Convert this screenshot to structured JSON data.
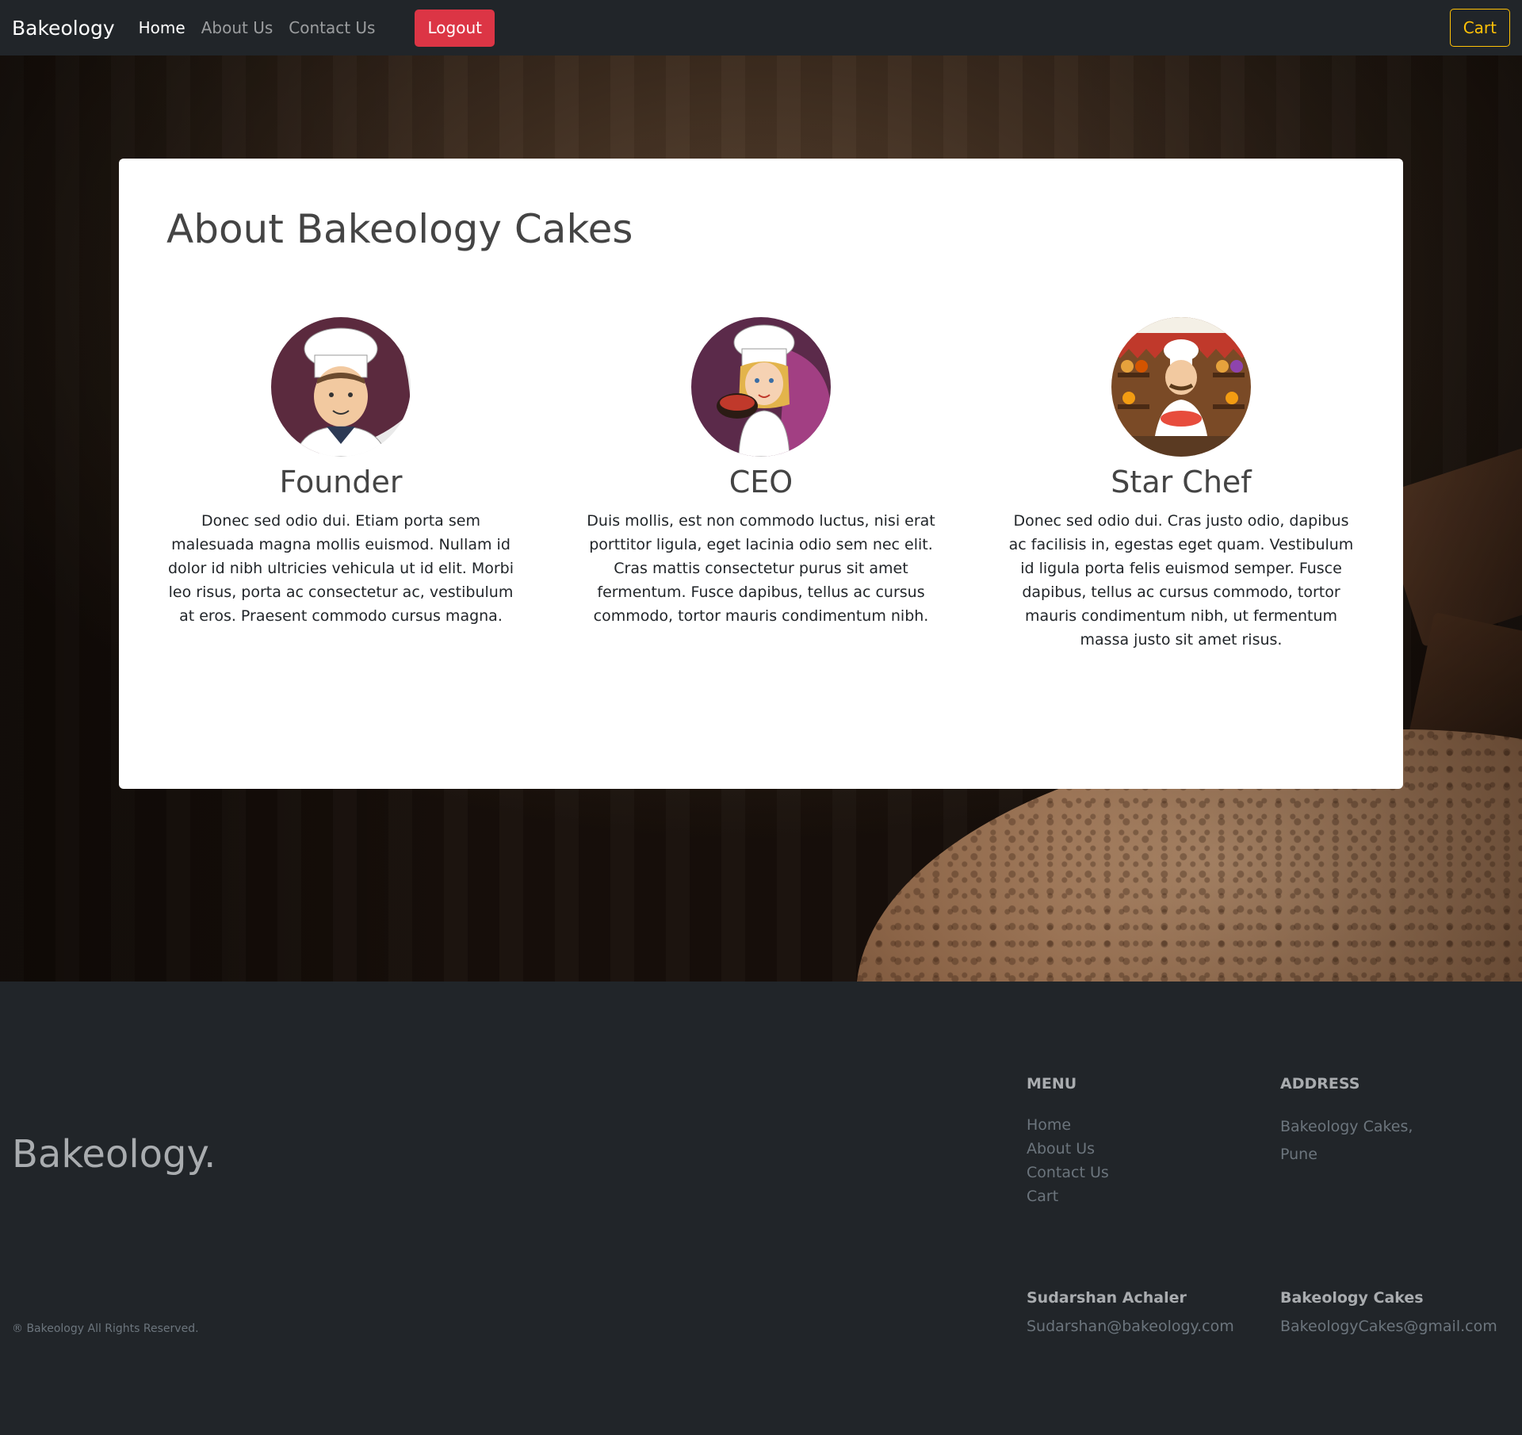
{
  "navbar": {
    "brand": "Bakeology",
    "links": [
      "Home",
      "About Us",
      "Contact Us"
    ],
    "logout": "Logout",
    "cart": "Cart"
  },
  "about": {
    "title": "About Bakeology Cakes",
    "members": [
      {
        "role": "Founder",
        "text": "Donec sed odio dui. Etiam porta sem malesuada magna mollis euismod. Nullam id dolor id nibh ultricies vehicula ut id elit. Morbi leo risus, porta ac consectetur ac, vestibulum at eros. Praesent commodo cursus magna.",
        "avatar": "chef-man-icon"
      },
      {
        "role": "CEO",
        "text": "Duis mollis, est non commodo luctus, nisi erat porttitor ligula, eget lacinia odio sem nec elit. Cras mattis consectetur purus sit amet fermentum. Fusce dapibus, tellus ac cursus commodo, tortor mauris condimentum nibh.",
        "avatar": "chef-woman-icon"
      },
      {
        "role": "Star Chef",
        "text": "Donec sed odio dui. Cras justo odio, dapibus ac facilisis in, egestas eget quam. Vestibulum id ligula porta felis euismod semper. Fusce dapibus, tellus ac cursus commodo, tortor mauris condimentum nibh, ut fermentum massa justo sit amet risus.",
        "avatar": "baker-shop-icon"
      }
    ]
  },
  "footer": {
    "brand": "Bakeology.",
    "copyright": "® Bakeology All Rights Reserved.",
    "menu": {
      "heading": "MENU",
      "links": [
        "Home",
        "About Us",
        "Contact Us",
        "Cart"
      ]
    },
    "address": {
      "heading": "ADDRESS",
      "lines": [
        "Bakeology Cakes,",
        "Pune"
      ]
    },
    "contacts": [
      {
        "name": "Sudarshan Achaler",
        "email": "Sudarshan@bakeology.com"
      },
      {
        "name": "Bakeology Cakes",
        "email": "BakeologyCakes@gmail.com"
      }
    ]
  },
  "colors": {
    "navbar": "#212529",
    "logout": "#dc3545",
    "cart": "#ffc107",
    "card": "#ffffff"
  }
}
